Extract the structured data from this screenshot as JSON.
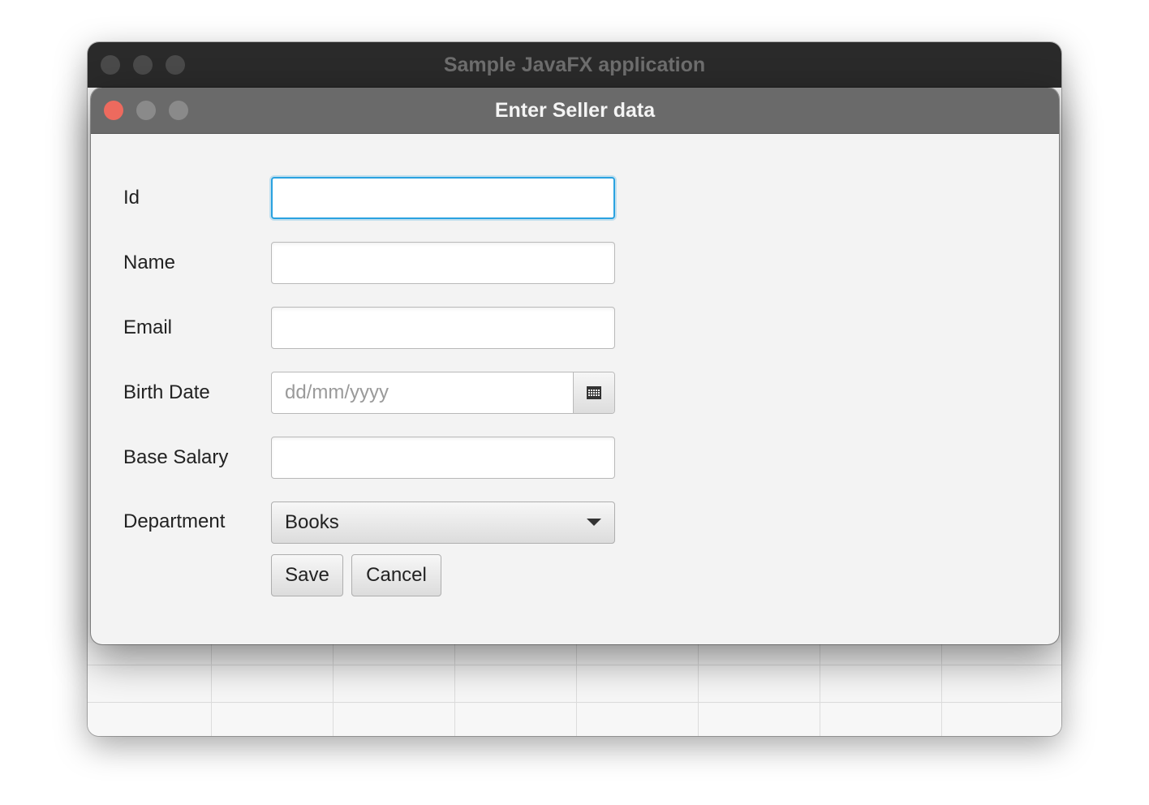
{
  "parent_window": {
    "title": "Sample JavaFX application"
  },
  "dialog": {
    "title": "Enter Seller data",
    "fields": {
      "id": {
        "label": "Id",
        "value": ""
      },
      "name": {
        "label": "Name",
        "value": ""
      },
      "email": {
        "label": "Email",
        "value": ""
      },
      "birth_date": {
        "label": "Birth Date",
        "value": "",
        "placeholder": "dd/mm/yyyy"
      },
      "base_salary": {
        "label": "Base Salary",
        "value": ""
      },
      "department": {
        "label": "Department",
        "selected": "Books"
      }
    },
    "buttons": {
      "save": "Save",
      "cancel": "Cancel"
    }
  },
  "colors": {
    "close": "#ed6a5e",
    "focus_ring": "#2aa2e0"
  }
}
